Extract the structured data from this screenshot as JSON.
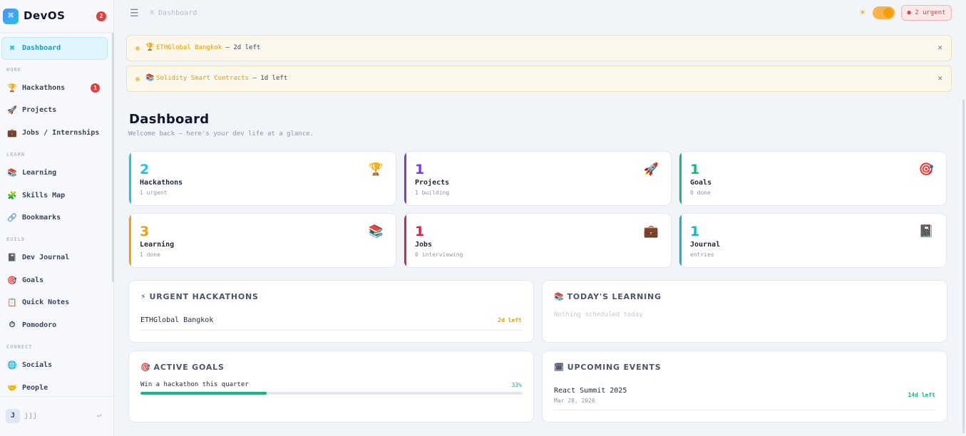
{
  "brand": {
    "name": "DevOS",
    "logo_glyph": "⌘",
    "badge": "2"
  },
  "nav": {
    "dashboard": {
      "label": "Dashboard",
      "icon": "⌘"
    },
    "sections": {
      "work": "WORK",
      "learn": "LEARN",
      "build": "BUILD",
      "connect": "CONNECT"
    },
    "items": [
      {
        "label": "Hackathons",
        "icon": "🏆",
        "badge": "1"
      },
      {
        "label": "Projects",
        "icon": "🚀"
      },
      {
        "label": "Jobs / Internships",
        "icon": "💼"
      },
      {
        "label": "Learning",
        "icon": "📚"
      },
      {
        "label": "Skills Map",
        "icon": "🧩"
      },
      {
        "label": "Bookmarks",
        "icon": "🔗"
      },
      {
        "label": "Dev Journal",
        "icon": "📓"
      },
      {
        "label": "Goals",
        "icon": "🎯"
      },
      {
        "label": "Quick Notes",
        "icon": "📋"
      },
      {
        "label": "Pomodoro",
        "icon": "⏱"
      },
      {
        "label": "Socials",
        "icon": "🌐"
      },
      {
        "label": "People",
        "icon": "🤝"
      }
    ]
  },
  "user": {
    "initial": "J",
    "name": "jjj"
  },
  "topbar": {
    "crumb": "⌘ Dashboard",
    "urgent": "● 2 urgent"
  },
  "alerts": [
    {
      "icon": "🏆",
      "name": "ETHGlobal Bangkok",
      "rest": " — 2d left"
    },
    {
      "icon": "📚",
      "name": "Solidity Smart Contracts",
      "rest": " — 1d left"
    }
  ],
  "page": {
    "title": "Dashboard",
    "subtitle": "Welcome back — here's your dev life at a glance."
  },
  "stats": [
    {
      "value": "2",
      "label": "Hackathons",
      "sub": "1 urgent",
      "icon": "🏆",
      "color": "#22c3e6"
    },
    {
      "value": "1",
      "label": "Projects",
      "sub": "1 building",
      "icon": "🚀",
      "color": "#7c3aed"
    },
    {
      "value": "1",
      "label": "Goals",
      "sub": "0 done",
      "icon": "🎯",
      "color": "#10b981"
    },
    {
      "value": "3",
      "label": "Learning",
      "sub": "1 done",
      "icon": "📚",
      "color": "#f59e0b"
    },
    {
      "value": "1",
      "label": "Jobs",
      "sub": "0 interviewing",
      "icon": "💼",
      "color": "#e11d48"
    },
    {
      "value": "1",
      "label": "Journal",
      "sub": "entries",
      "icon": "📓",
      "color": "#14b8c4"
    }
  ],
  "panels": {
    "urgent": {
      "icon": "⚡",
      "title": "URGENT HACKATHONS",
      "item": "ETHGlobal Bangkok",
      "right": "2d left"
    },
    "learning": {
      "icon": "📚",
      "title": "TODAY'S LEARNING",
      "empty": "Nothing scheduled today"
    },
    "goals": {
      "icon": "🎯",
      "title": "ACTIVE GOALS",
      "item": "Win a hackathon this quarter",
      "percent": "33%",
      "progress": 0.33
    },
    "events": {
      "icon": "🗓",
      "title": "UPCOMING EVENTS",
      "item": "React Summit 2025",
      "date": "Mar 28, 2026",
      "right": "14d left"
    }
  }
}
